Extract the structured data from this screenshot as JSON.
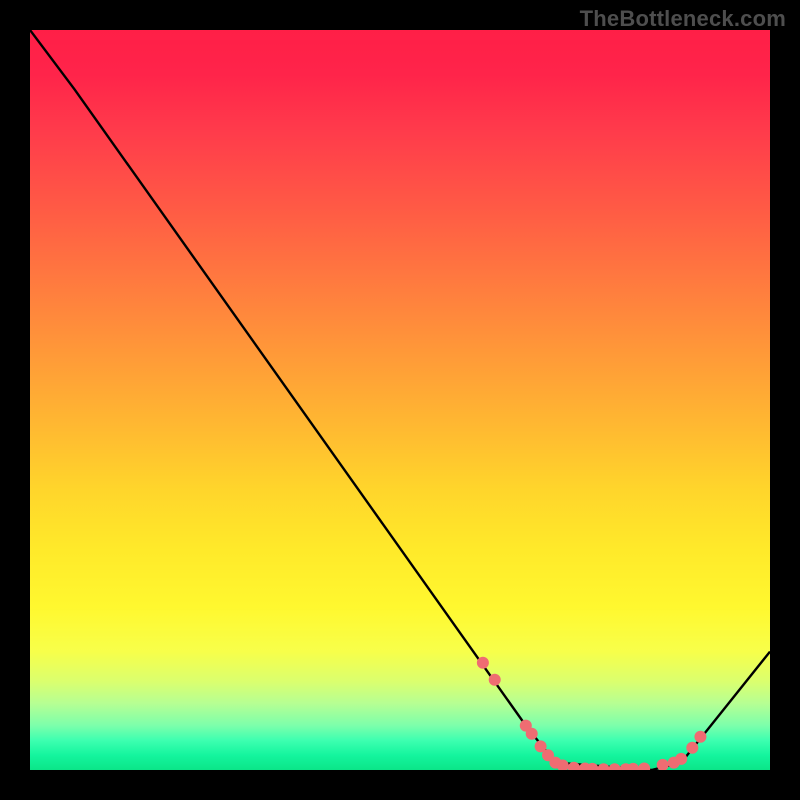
{
  "watermark": "TheBottleneck.com",
  "chart_data": {
    "type": "line",
    "title": "",
    "xlabel": "",
    "ylabel": "",
    "xlim": [
      0,
      100
    ],
    "ylim": [
      0,
      100
    ],
    "series": [
      {
        "name": "curve",
        "x": [
          0,
          6,
          67,
          71,
          84,
          88,
          100
        ],
        "y": [
          100,
          92,
          6,
          1,
          0,
          1,
          16
        ]
      }
    ],
    "markers": {
      "name": "dots",
      "x": [
        61.2,
        62.8,
        67.0,
        67.8,
        69.0,
        70.0,
        71.0,
        72.0,
        73.5,
        75.0,
        76.0,
        77.5,
        79.0,
        80.5,
        81.5,
        83.0,
        85.5,
        87.0,
        88.0,
        89.5,
        90.6
      ],
      "y": [
        14.5,
        12.2,
        6.0,
        4.9,
        3.2,
        2.0,
        1.0,
        0.6,
        0.3,
        0.2,
        0.15,
        0.1,
        0.1,
        0.1,
        0.15,
        0.2,
        0.7,
        1.0,
        1.5,
        3.0,
        4.5
      ]
    },
    "colors": {
      "curve": "#000000",
      "marker_fill": "#ef6c72",
      "marker_stroke": "#ef6c72"
    }
  }
}
